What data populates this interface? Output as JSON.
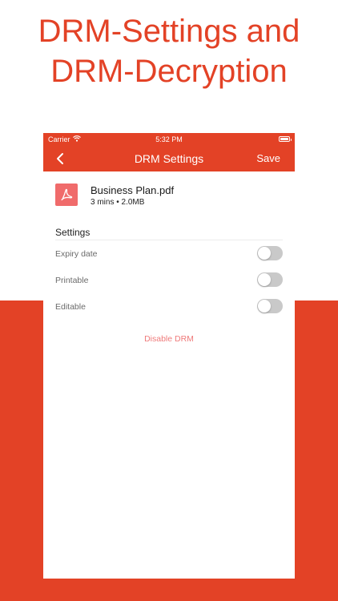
{
  "headline": {
    "line1": "DRM-Settings and",
    "line2": "DRM-Decryption"
  },
  "colors": {
    "accent": "#e34226",
    "pdf_icon": "#f06b6b",
    "toggle_off": "#c9c9c9",
    "destructive_link": "#ef7a7a"
  },
  "status_bar": {
    "carrier": "Carrier",
    "time": "5:32 PM"
  },
  "nav": {
    "title": "DRM Settings",
    "save_label": "Save",
    "back_icon": "chevron-left-icon"
  },
  "file": {
    "name": "Business Plan.pdf",
    "meta": "3 mins • 2.0MB",
    "icon": "pdf-icon"
  },
  "settings": {
    "section_title": "Settings",
    "items": [
      {
        "label": "Expiry date",
        "enabled": false
      },
      {
        "label": "Printable",
        "enabled": false
      },
      {
        "label": "Editable",
        "enabled": false
      }
    ]
  },
  "actions": {
    "disable_drm": "Disable DRM"
  }
}
